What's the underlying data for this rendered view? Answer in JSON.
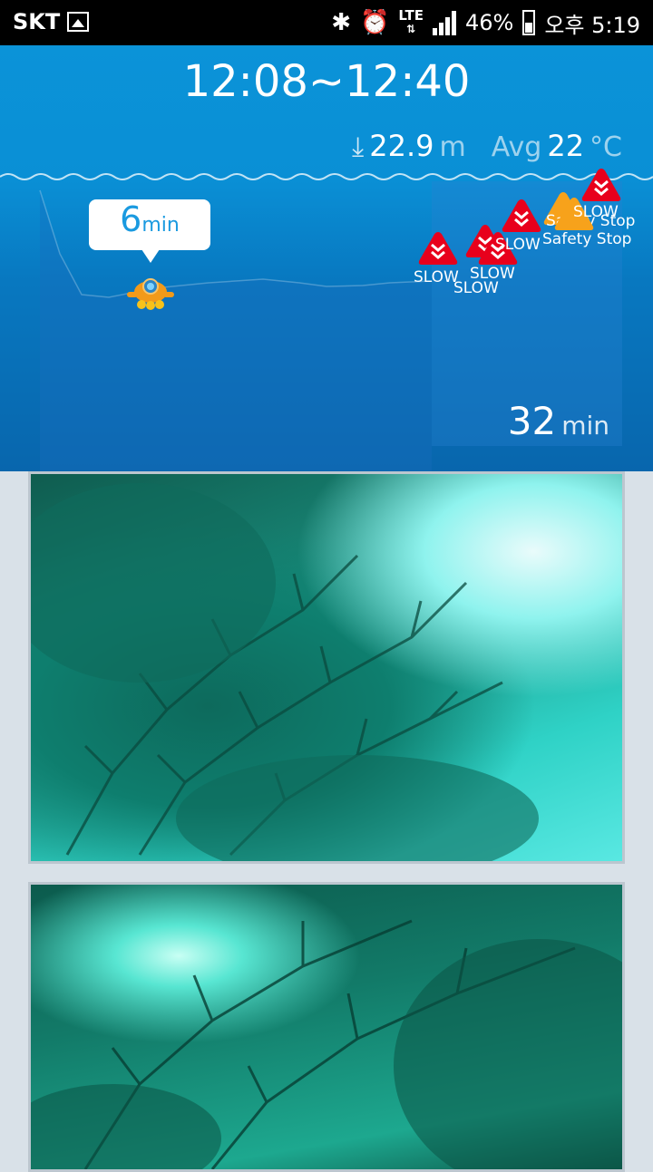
{
  "status_bar": {
    "carrier": "SKT",
    "network": "LTE",
    "battery": "46%",
    "time": "오후 5:19",
    "icons": [
      "gallery-icon",
      "bluetooth-icon",
      "alarm-icon",
      "signal-icon",
      "battery-icon"
    ]
  },
  "dive": {
    "time_range": "12:08~12:40",
    "max_depth": "22.9",
    "depth_unit": "m",
    "avg_label": "Avg",
    "avg_temp": "22",
    "temp_unit": "°C",
    "marker_value": "6",
    "marker_unit": "min",
    "duration_value": "32",
    "duration_unit": "min",
    "alerts": [
      {
        "type": "slow",
        "label": "SLOW",
        "color": "#e8001c"
      },
      {
        "type": "slow",
        "label": "SLOW",
        "color": "#e8001c"
      },
      {
        "type": "slow",
        "label": "SLOW",
        "color": "#e8001c"
      },
      {
        "type": "slow",
        "label": "SLOW",
        "color": "#e8001c"
      },
      {
        "type": "safety",
        "label": "Safety Stop",
        "color": "#f7a21b"
      },
      {
        "type": "safety",
        "label": "Safety Stop",
        "color": "#f7a21b"
      },
      {
        "type": "slow",
        "label": "SLOW",
        "color": "#e8001c"
      }
    ]
  },
  "photos": [
    {
      "name": "coral-photo-1"
    },
    {
      "name": "coral-photo-2"
    }
  ],
  "colors": {
    "header_top": "#0b93d8",
    "header_bottom": "#0866ad",
    "slow_alert": "#e8001c",
    "safety_alert": "#f7a21b",
    "bubble_text": "#1a9ae0"
  }
}
